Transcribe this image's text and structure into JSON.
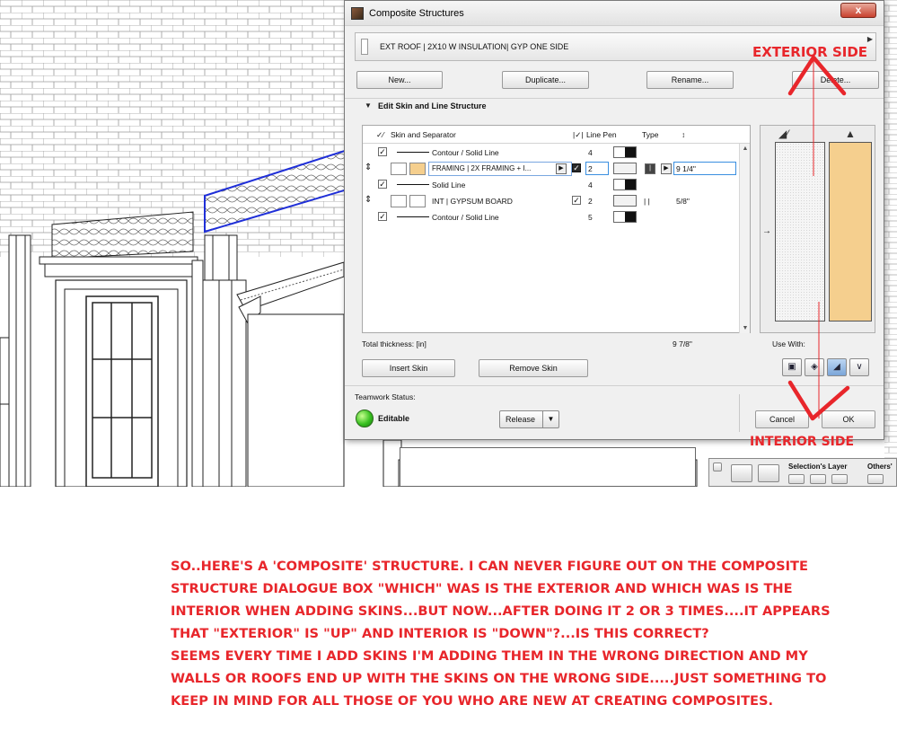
{
  "dialog": {
    "title": "Composite Structures",
    "close_label": "x",
    "composite_name": "EXT ROOF | 2X10 W INSULATION| GYP ONE SIDE",
    "buttons": {
      "new": "New...",
      "duplicate": "Duplicate...",
      "rename": "Rename...",
      "delete": "Delete...",
      "insert_skin": "Insert Skin",
      "remove_skin": "Remove Skin",
      "cancel": "Cancel",
      "ok": "OK"
    },
    "section_title": "Edit Skin and Line Structure",
    "table": {
      "headers": {
        "skin": "Skin and Separator",
        "line_pen": "Line Pen",
        "type": "Type"
      },
      "rows": [
        {
          "label": "Contour / Solid Line",
          "pen": "4"
        },
        {
          "label": "FRAMING | 2X FRAMING + I...",
          "pen": "2",
          "thickness": "9 1/4\""
        },
        {
          "label": "Solid Line",
          "pen": "4"
        },
        {
          "label": "INT | GYPSUM BOARD",
          "pen": "2",
          "thickness": "5/8\""
        },
        {
          "label": "Contour / Solid Line",
          "pen": "5"
        }
      ]
    },
    "total_label": "Total thickness: [in]",
    "total_value": "9 7/8\"",
    "use_with_label": "Use With:",
    "teamwork_label": "Teamwork Status:",
    "status": "Editable",
    "release_label": "Release"
  },
  "annotations": {
    "exterior": "EXTERIOR SIDE",
    "interior": "INTERIOR SIDE",
    "comment": "SO..HERE'S A 'COMPOSITE' STRUCTURE. I CAN NEVER FIGURE OUT ON THE COMPOSITE\nSTRUCTURE DIALOGUE BOX \"WHICH\" WAS IS THE EXTERIOR AND WHICH WAS IS THE\nINTERIOR WHEN ADDING SKINS...BUT NOW...AFTER DOING IT 2 OR 3 TIMES....IT APPEARS\nTHAT \"EXTERIOR\" IS \"UP\" AND INTERIOR IS \"DOWN\"?...IS THIS CORRECT?\nSEEMS EVERY TIME I ADD SKINS I'M ADDING THEM IN THE WRONG DIRECTION AND MY\nWALLS OR ROOFS END UP WITH THE SKINS ON THE WRONG SIDE.....JUST SOMETHING TO\nKEEP IN MIND FOR ALL THOSE OF YOU WHO ARE NEW AT CREATING COMPOSITES."
  },
  "layer_panel": {
    "title": "Selection's Layer",
    "others": "Others'"
  },
  "colors": {
    "annotation_red": "#e8262b",
    "skin_insulation": "#f5cf8e",
    "roof_highlight": "#1f2fd8",
    "status_green": "#38c020"
  },
  "icons": {
    "preview_left": "section-cut-icon",
    "preview_right": "brush-icon",
    "status": "green-status-icon"
  }
}
